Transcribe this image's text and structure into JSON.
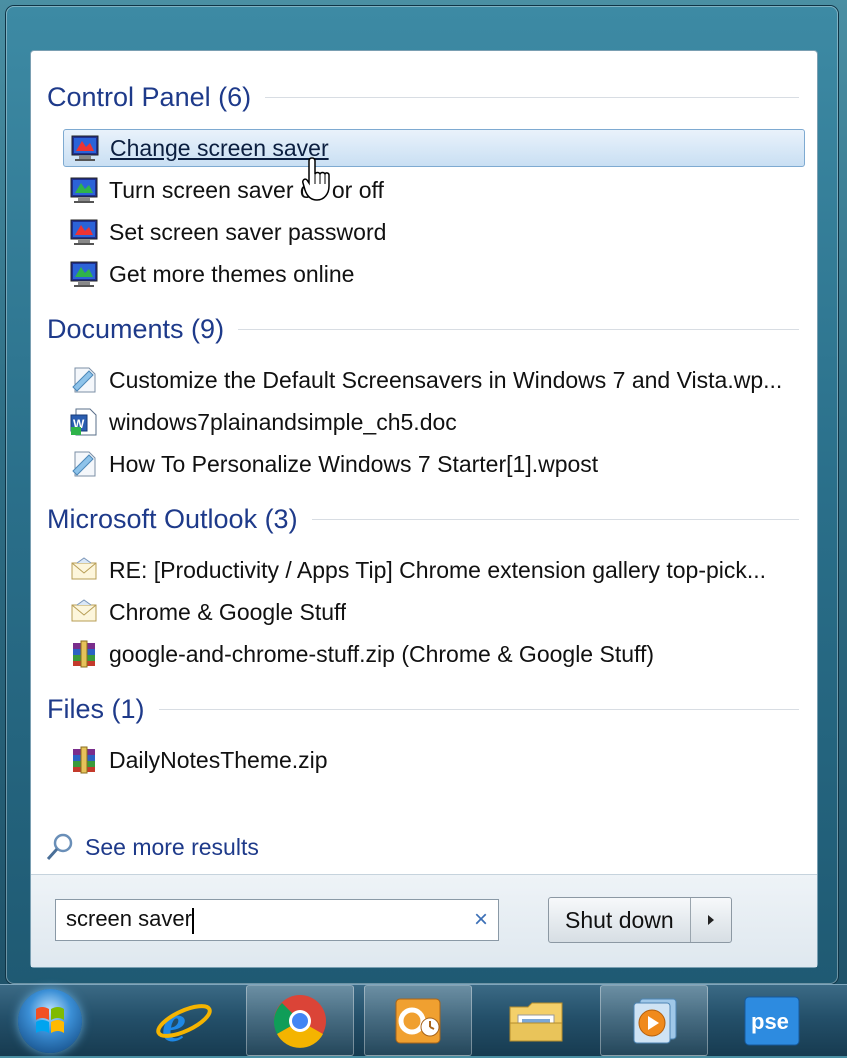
{
  "sections": [
    {
      "title": "Control Panel (6)",
      "items": [
        {
          "label": "Change screen saver",
          "icon": "display-properties-icon",
          "selected": true
        },
        {
          "label": "Turn screen saver on or off",
          "icon": "display-properties-icon"
        },
        {
          "label": "Set screen saver password",
          "icon": "display-properties-icon"
        },
        {
          "label": "Get more themes online",
          "icon": "display-properties-icon"
        }
      ]
    },
    {
      "title": "Documents (9)",
      "items": [
        {
          "label": "Customize the Default Screensavers in Windows 7 and Vista.wp...",
          "icon": "wpost-document-icon"
        },
        {
          "label": "windows7plainandsimple_ch5.doc",
          "icon": "word-document-icon"
        },
        {
          "label": "How To Personalize Windows 7 Starter[1].wpost",
          "icon": "wpost-document-icon"
        }
      ]
    },
    {
      "title": "Microsoft Outlook (3)",
      "items": [
        {
          "label": "RE: [Productivity / Apps Tip] Chrome extension gallery top-pick...",
          "icon": "email-envelope-icon"
        },
        {
          "label": "Chrome & Google Stuff",
          "icon": "email-envelope-icon"
        },
        {
          "label": "google-and-chrome-stuff.zip (Chrome & Google Stuff)",
          "icon": "zip-archive-icon"
        }
      ]
    },
    {
      "title": "Files (1)",
      "items": [
        {
          "label": "DailyNotesTheme.zip",
          "icon": "zip-archive-icon"
        }
      ]
    }
  ],
  "see_more": "See more results",
  "search": {
    "value": "screen saver",
    "clear_icon": "clear-icon"
  },
  "shutdown": {
    "label": "Shut down"
  },
  "taskbar": {
    "items": [
      "start-orb-icon",
      "internet-explorer-icon",
      "chrome-icon",
      "outlook-icon",
      "file-explorer-icon",
      "media-player-icon",
      "photoshop-elements-icon"
    ],
    "pse_label": "pse"
  },
  "colors": {
    "accent": "#1e3a8a",
    "selection": "#c9dff3"
  }
}
